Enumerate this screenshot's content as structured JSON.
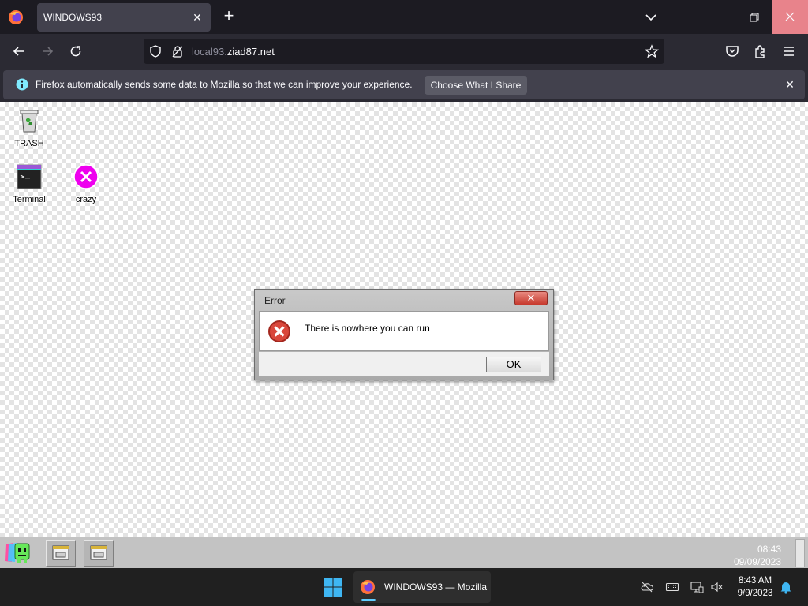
{
  "browser": {
    "tab": {
      "title": "WINDOWS93",
      "close_glyph": "✕"
    },
    "new_tab_glyph": "+",
    "url": {
      "prefix": "local93.",
      "domain": "ziad87.net"
    },
    "notification": {
      "text": "Firefox automatically sends some data to Mozilla so that we can improve your experience.",
      "button_label": "Choose What I Share",
      "close_glyph": "✕"
    }
  },
  "desktop": {
    "icons": [
      {
        "label": "TRASH"
      },
      {
        "label": "Terminal"
      },
      {
        "label": "crazy"
      }
    ],
    "dialog": {
      "title": "Error",
      "close_glyph": "✕",
      "message": "There is nowhere you can run",
      "ok_label": "OK"
    },
    "taskbar": {
      "time": "08:43",
      "date": "09/09/2023"
    }
  },
  "os_taskbar": {
    "app_label": "WINDOWS93 — Mozilla",
    "time": "8:43 AM",
    "date": "9/9/2023"
  },
  "colors": {
    "browser_dark": "#1c1b22",
    "close_hover": "#e8838b",
    "error_red": "#c0392b",
    "accent_blue": "#60cdff"
  }
}
